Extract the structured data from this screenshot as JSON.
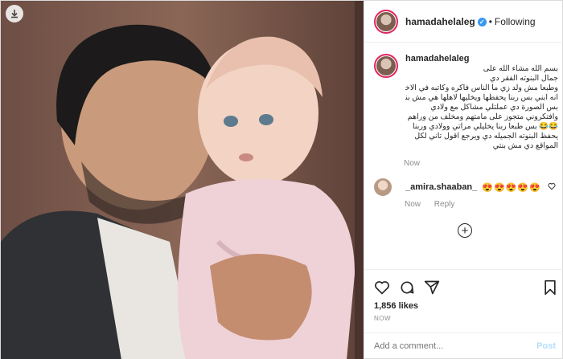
{
  "post": {
    "username": "hamadahelaleg",
    "follow_state": "Following",
    "separator": "•",
    "verified_mark": "✓",
    "caption_lines": [
      "بسم الله مشاء الله على",
      "جمال البنوته الفقر دي",
      "وطبعا مش ولد زي ما الناس فاكره وكاتبه في الاخبار",
      "انه ابني بس ربنا يحفظها ويخليها لاهلها هي مش بنتي",
      "بس الصورة دي عملتلي مشاكل مع ولادي",
      "وافتكروني متجوز على مامتهم ومخلف من وراهم",
      "😂😂 بس طبعا ربنا يخليلي مراتي وولادي وربنا",
      "يحفظ البنوته الجميله دي ويرجع اقول تاني لكل",
      "المواقع دي مش بنتي"
    ],
    "caption_time": "Now",
    "comment": {
      "username": "_amira.shaaban_",
      "text": "😍😍😍😍😍"
    },
    "comment_time": "Now",
    "reply_label": "Reply",
    "load_more": "+",
    "likes": "1,856 likes",
    "timestamp": "NOW",
    "add_comment_placeholder": "Add a comment...",
    "post_button": "Post"
  },
  "icons": {
    "download": "download-icon",
    "like": "heart-icon",
    "comment": "comment-icon",
    "share": "share-icon",
    "save": "bookmark-icon"
  },
  "colors": {
    "accent": "#3897f0",
    "post_disabled": "#b2dffc",
    "muted": "#8e8e8e",
    "border": "#dbdbdb"
  }
}
